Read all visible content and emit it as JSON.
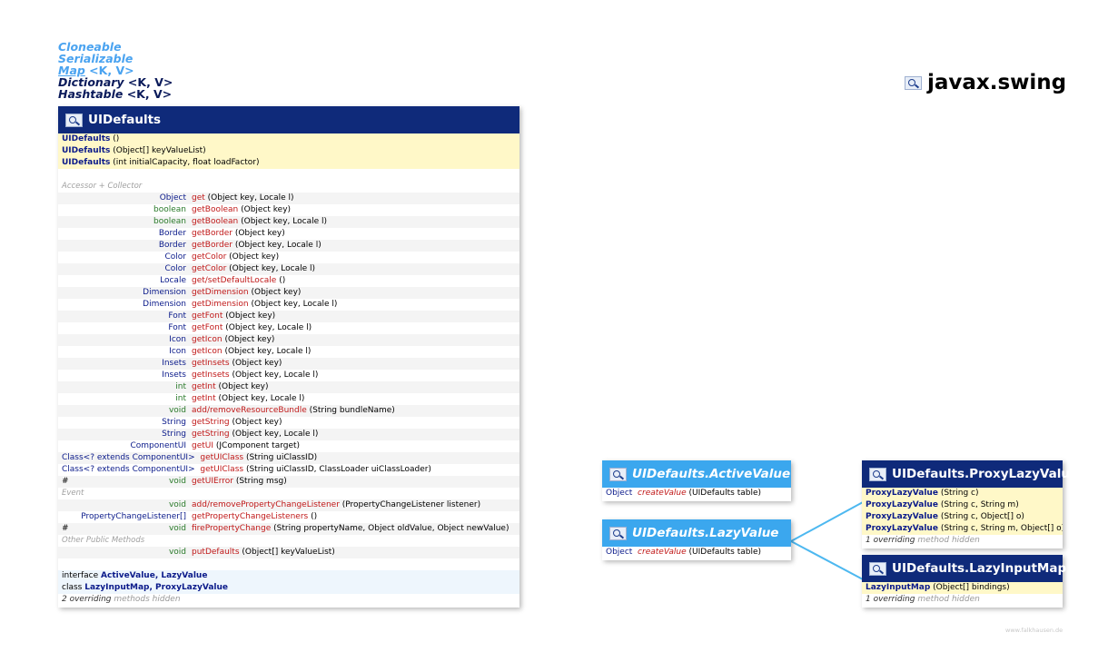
{
  "inheritance": [
    {
      "name": "Cloneable",
      "generic": "",
      "kind": "iface"
    },
    {
      "name": "Serializable",
      "generic": "",
      "kind": "iface"
    },
    {
      "name": "Map",
      "generic": " <K, V>",
      "kind": "iface"
    },
    {
      "name": "Dictionary",
      "generic": " <K, V>",
      "kind": "cls"
    },
    {
      "name": "Hashtable",
      "generic": " <K, V>",
      "kind": "cls"
    }
  ],
  "package": "javax.swing",
  "main": {
    "title": "UIDefaults",
    "ctor1_name": "UIDefaults",
    "ctor1_args": " ()",
    "ctor2_name": "UIDefaults",
    "ctor2_args": " (Object[] keyValueList)",
    "ctor3_name": "UIDefaults",
    "ctor3_args": " (int initialCapacity, float loadFactor)",
    "sec_accessor": "Accessor + Collector",
    "sec_event": "Event",
    "sec_other": "Other Public Methods",
    "methods": [
      {
        "r": "Object",
        "n": "get",
        "a": " (Object key, Locale l)"
      },
      {
        "r": "boolean",
        "n": "getBoolean",
        "a": " (Object key)"
      },
      {
        "r": "boolean",
        "n": "getBoolean",
        "a": " (Object key, Locale l)"
      },
      {
        "r": "Border",
        "n": "getBorder",
        "a": " (Object key)"
      },
      {
        "r": "Border",
        "n": "getBorder",
        "a": " (Object key, Locale l)"
      },
      {
        "r": "Color",
        "n": "getColor",
        "a": " (Object key)"
      },
      {
        "r": "Color",
        "n": "getColor",
        "a": " (Object key, Locale l)"
      },
      {
        "r": "Locale",
        "n": "get/setDefaultLocale",
        "a": " ()"
      },
      {
        "r": "Dimension",
        "n": "getDimension",
        "a": " (Object key)"
      },
      {
        "r": "Dimension",
        "n": "getDimension",
        "a": " (Object key, Locale l)"
      },
      {
        "r": "Font",
        "n": "getFont",
        "a": " (Object key)"
      },
      {
        "r": "Font",
        "n": "getFont",
        "a": " (Object key, Locale l)"
      },
      {
        "r": "Icon",
        "n": "getIcon",
        "a": " (Object key)"
      },
      {
        "r": "Icon",
        "n": "getIcon",
        "a": " (Object key, Locale l)"
      },
      {
        "r": "Insets",
        "n": "getInsets",
        "a": " (Object key)"
      },
      {
        "r": "Insets",
        "n": "getInsets",
        "a": " (Object key, Locale l)"
      },
      {
        "r": "int",
        "n": "getInt",
        "a": " (Object key)"
      },
      {
        "r": "int",
        "n": "getInt",
        "a": " (Object key, Locale l)"
      },
      {
        "r": "void",
        "n": "add/removeResourceBundle",
        "a": " (String bundleName)"
      },
      {
        "r": "String",
        "n": "getString",
        "a": " (Object key)"
      },
      {
        "r": "String",
        "n": "getString",
        "a": " (Object key, Locale l)"
      },
      {
        "r": "ComponentUI",
        "n": "getUI",
        "a": " (JComponent target)"
      }
    ],
    "cls1_r": "Class<? extends ComponentUI>",
    "cls1_n": "getUIClass",
    "cls1_a": " (String uiClassID)",
    "cls2_r": "Class<? extends ComponentUI>",
    "cls2_n": "getUIClass",
    "cls2_a": " (String uiClassID, ClassLoader uiClassLoader)",
    "err_h": "#",
    "err_r": "void",
    "err_n": "getUIError",
    "err_a": " (String msg)",
    "ev1_r": "void",
    "ev1_n": "add/removePropertyChangeListener",
    "ev1_a": " (PropertyChangeListener listener)",
    "ev2_r": "PropertyChangeListener[]",
    "ev2_n": "getPropertyChangeListeners",
    "ev2_a": " ()",
    "ev3_h": "#",
    "ev3_r": "void",
    "ev3_n": "firePropertyChange",
    "ev3_a": " (String propertyName, Object oldValue, Object newValue)",
    "op_r": "void",
    "op_n": "putDefaults",
    "op_a": " (Object[] keyValueList)",
    "inner1_pre": "interface ",
    "inner1_names": "ActiveValue, LazyValue",
    "inner2_pre": "class ",
    "inner2_names": "LazyInputMap, ProxyLazyValue",
    "hidden_count": "2 overriding",
    "hidden_text": " methods hidden"
  },
  "active": {
    "title": "UIDefaults.ActiveValue",
    "r": "Object",
    "n": "createValue",
    "a": " (UIDefaults table)"
  },
  "lazy": {
    "title": "UIDefaults.LazyValue",
    "r": "Object",
    "n": "createValue",
    "a": " (UIDefaults table)"
  },
  "proxy": {
    "title": "UIDefaults.ProxyLazyValue",
    "ctors": [
      {
        "n": "ProxyLazyValue",
        "a": " (String c)"
      },
      {
        "n": "ProxyLazyValue",
        "a": " (String c, String m)"
      },
      {
        "n": "ProxyLazyValue",
        "a": " (String c, Object[] o)"
      },
      {
        "n": "ProxyLazyValue",
        "a": " (String c, String m, Object[] o)"
      }
    ],
    "hidden_count": "1 overriding",
    "hidden_text": " method hidden"
  },
  "inputmap": {
    "title": "UIDefaults.LazyInputMap",
    "ctor_n": "LazyInputMap",
    "ctor_a": " (Object[] bindings)",
    "hidden_count": "1 overriding",
    "hidden_text": " method hidden"
  },
  "footer": "www.falkhausen.de",
  "colors": {
    "header_dark": "#0f2a7a",
    "header_light": "#3ba7ee",
    "ctor_bg": "#fff8c8",
    "connector": "#4db8f0"
  }
}
